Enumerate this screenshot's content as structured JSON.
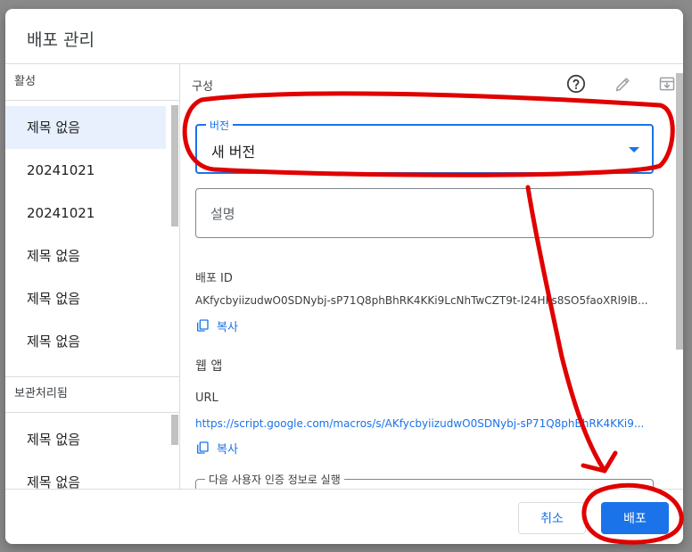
{
  "dialog": {
    "title": "배포 관리"
  },
  "left": {
    "active_header": "활성",
    "active_items": [
      "제목 없음",
      "20241021",
      "20241021",
      "제목 없음",
      "제목 없음",
      "제목 없음"
    ],
    "archived_header": "보관처리됨",
    "archived_items": [
      "제목 없음",
      "제목 없음"
    ]
  },
  "right": {
    "config_label": "구성",
    "icons": [
      "help-icon",
      "edit-icon",
      "archive-icon"
    ],
    "version_field": {
      "label": "버전",
      "value": "새 버전"
    },
    "description_field": {
      "placeholder": "설명"
    },
    "deploy_id": {
      "label": "배포 ID",
      "value": "AKfycbyiizudwO0SDNybj-sP71Q8phBhRK4KKi9LcNhTwCZT9t-l24HPs8SO5faoXRl9lB...",
      "copy_label": "복사"
    },
    "web_app": {
      "title": "웹 앱",
      "url_label": "URL",
      "url_value": "https://script.google.com/macros/s/AKfycbyiizudwO0SDNybj-sP71Q8phBhRK4KKi9...",
      "copy_label": "복사",
      "run_as_label": "다음 사용자 인증 정보로 실행"
    }
  },
  "footer": {
    "cancel_label": "취소",
    "deploy_label": "배포"
  },
  "colors": {
    "accent": "#1a73e8",
    "annotation": "#e00000"
  }
}
